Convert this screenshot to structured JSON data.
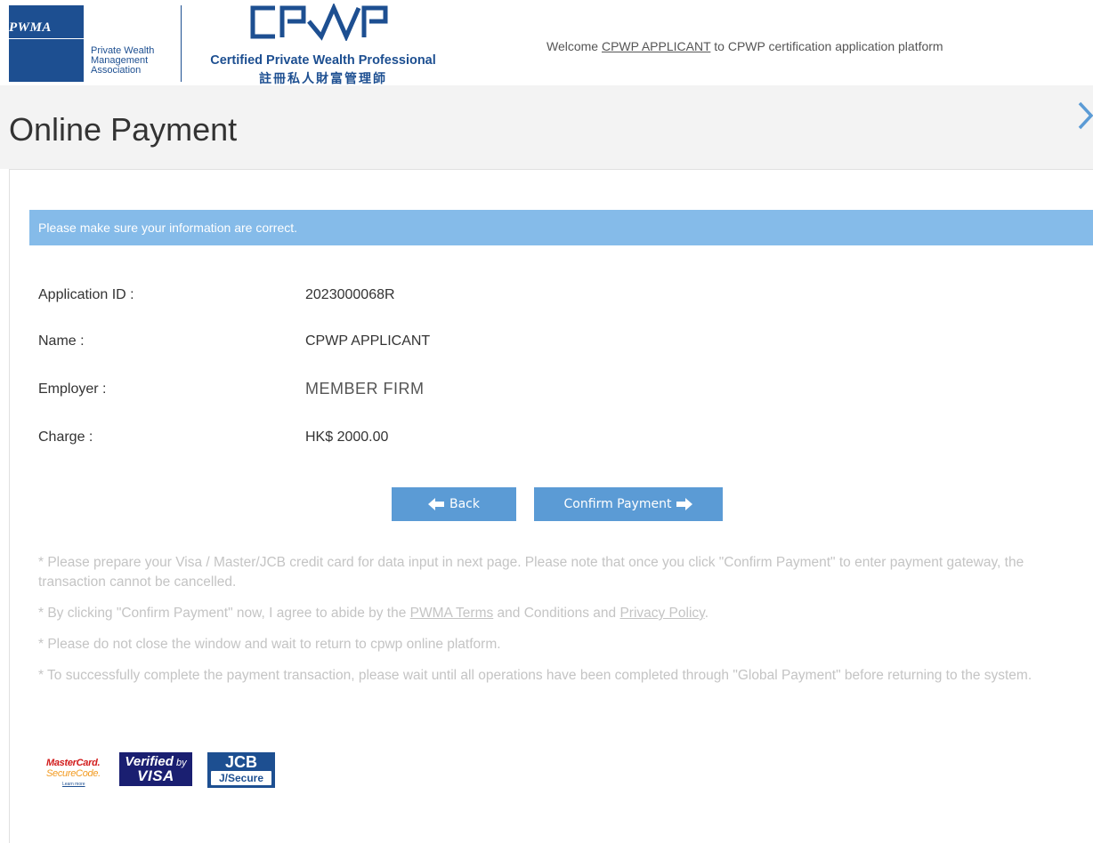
{
  "header": {
    "pwma_logo_text": "PWMA",
    "pwma_name_lines": [
      "Private Wealth",
      "Management",
      "Association"
    ],
    "cpwp_title": "Certified Private Wealth Professional",
    "cpwp_chinese": "註冊私人財富管理師",
    "welcome_prefix": "Welcome ",
    "welcome_user": "CPWP APPLICANT",
    "welcome_suffix": " to CPWP certification application platform"
  },
  "page": {
    "title": "Online Payment"
  },
  "notice": "Please make sure your information are correct.",
  "info": {
    "application_id_label": "Application ID :",
    "application_id_value": "2023000068R",
    "name_label": "Name :",
    "name_value": "CPWP APPLICANT",
    "employer_label": "Employer :",
    "employer_value": "MEMBER FIRM",
    "charge_label": "Charge :",
    "charge_value": "HK$ 2000.00"
  },
  "buttons": {
    "back": "Back",
    "confirm": "Confirm Payment"
  },
  "notes": {
    "note1": "* Please prepare your Visa / Master/JCB credit card for data input in next page. Please note that once you click \"Confirm Payment\" to enter payment gateway, the transaction cannot be cancelled.",
    "note2_prefix": "* By clicking \"Confirm Payment\" now, I agree to abide by the ",
    "note2_terms_link": "PWMA Terms",
    "note2_middle": " and Conditions and ",
    "note2_privacy_link": "Privacy Policy",
    "note2_suffix": ".",
    "note3": "* Please do not close the window and wait to return to cpwp online platform.",
    "note4": "* To successfully complete the payment transaction, please wait until all operations have been completed through \"Global Payment\" before returning to the system."
  },
  "card_logos": {
    "mastercard_line1": "MasterCard.",
    "mastercard_line2": "SecureCode.",
    "mastercard_link": "Learn more",
    "visa_line1_a": "Verified",
    "visa_line1_b": " by",
    "visa_line2": "VISA",
    "jcb_line1": "JCB",
    "jcb_line2": "J/Secure"
  },
  "colors": {
    "brand_blue": "#1d4f91",
    "notice_bg": "#85bbe9",
    "button_bg": "#5b9bd5",
    "title_bar_bg": "#f3f3f3",
    "note_text": "#c4c4c4"
  },
  "icons": [
    "chevron-right-icon",
    "arrow-left-icon",
    "arrow-right-icon"
  ]
}
